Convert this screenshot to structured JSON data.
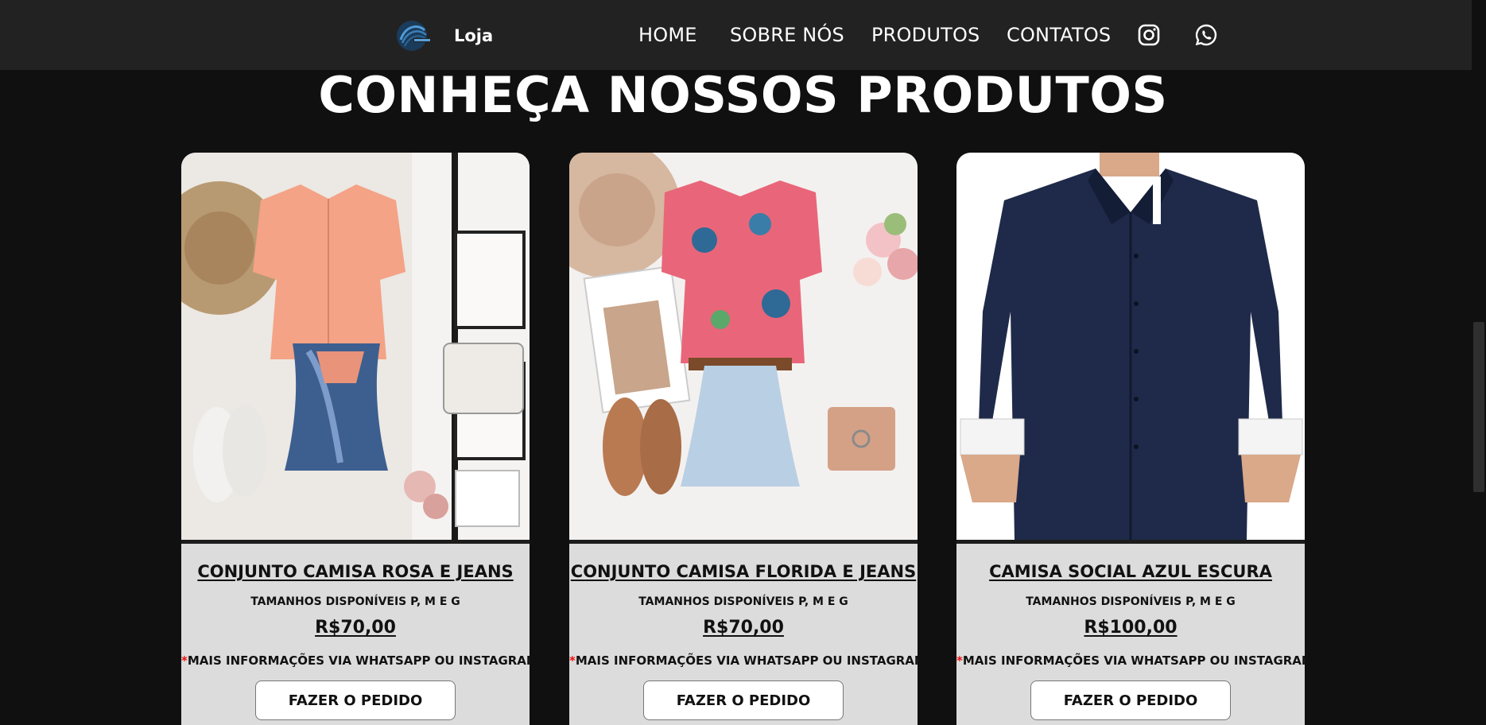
{
  "header": {
    "brand": "Loja",
    "nav": [
      {
        "label": "HOME"
      },
      {
        "label": "SOBRE NÓS"
      },
      {
        "label": "PRODUTOS"
      },
      {
        "label": "CONTATOS"
      }
    ],
    "social_icons": [
      "instagram-icon",
      "whatsapp-icon"
    ]
  },
  "main": {
    "title": "CONHEÇA NOSSOS PRODUTOS",
    "products": [
      {
        "name": "CONJUNTO CAMISA ROSA E JEANS",
        "sizes": "TAMANHOS DISPONÍVEIS P, M E G",
        "price": "R$70,00",
        "info_mark": "*",
        "info": "MAIS INFORMAÇÕES VIA WHATSAPP OU INSTAGRAM",
        "button": "FAZER O PEDIDO"
      },
      {
        "name": "CONJUNTO CAMISA FLORIDA E JEANS",
        "sizes": "TAMANHOS DISPONÍVEIS P, M E G",
        "price": "R$70,00",
        "info_mark": "*",
        "info": "MAIS INFORMAÇÕES VIA WHATSAPP OU INSTAGRAM",
        "button": "FAZER O PEDIDO"
      },
      {
        "name": "CAMISA SOCIAL AZUL ESCURA",
        "sizes": "TAMANHOS DISPONÍVEIS P, M E G",
        "price": "R$100,00",
        "info_mark": "*",
        "info": "MAIS INFORMAÇÕES VIA WHATSAPP OU INSTAGRAM",
        "button": "FAZER O PEDIDO"
      }
    ]
  },
  "colors": {
    "page_bg": "#101010",
    "navbar_bg": "#222222",
    "card_bg": "#dcdcdc",
    "accent_star": "#ee1111"
  }
}
